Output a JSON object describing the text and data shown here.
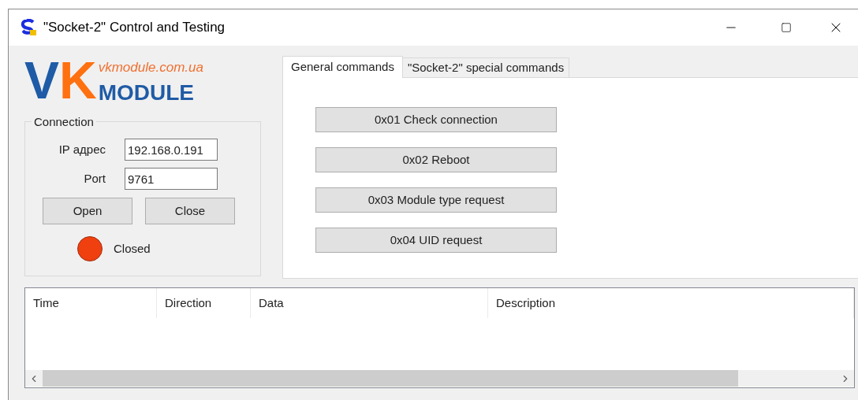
{
  "window": {
    "title": "\"Socket-2\" Control and Testing"
  },
  "logo": {
    "mark_left": "V",
    "mark_right": "K",
    "word": "MODULE",
    "url": "vkmodule.com.ua"
  },
  "connection": {
    "title": "Connection",
    "fields": [
      {
        "label": "IP адрес",
        "value": "192.168.0.191"
      },
      {
        "label": "Port",
        "value": "9761"
      }
    ],
    "buttons": [
      "Open",
      "Close"
    ],
    "status": {
      "text": "Closed",
      "color": "#f04010"
    }
  },
  "tabs": [
    {
      "label": "General commands",
      "selected": true
    },
    {
      "label": "\"Socket-2\" special commands",
      "selected": false
    }
  ],
  "commands": [
    "0x01 Check connection",
    "0x02 Reboot",
    "0x03 Module type request",
    "0x04 UID request"
  ],
  "log": {
    "columns": [
      "Time",
      "Direction",
      "Data",
      "Description"
    ]
  }
}
